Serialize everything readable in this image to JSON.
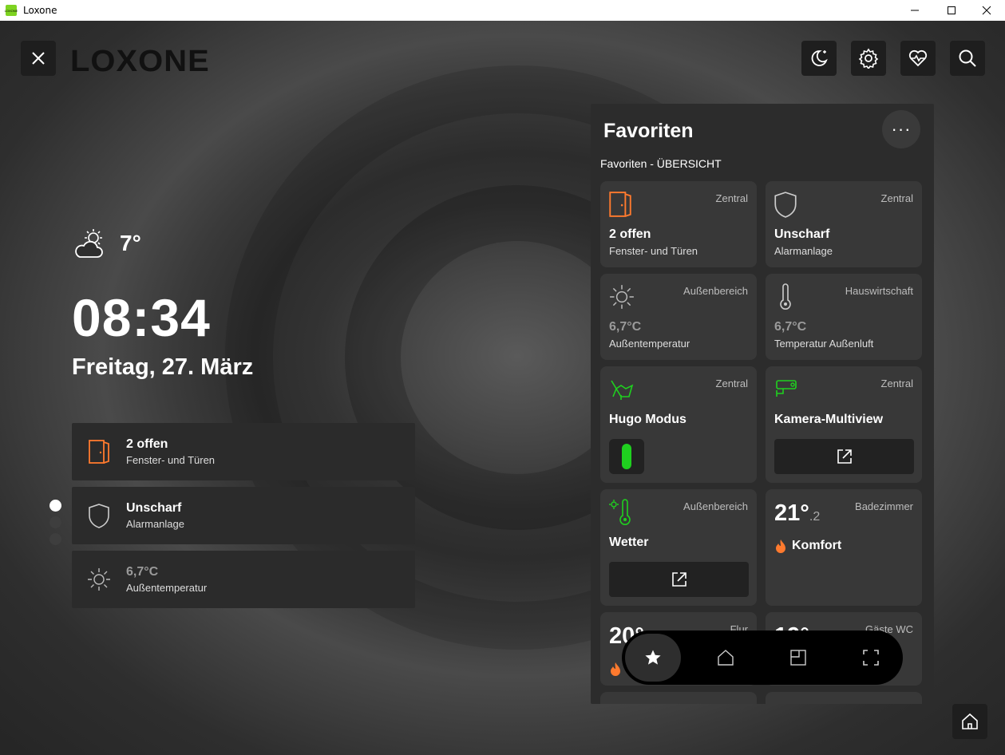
{
  "window": {
    "title": "Loxone",
    "app_icon_text": "LOXONE"
  },
  "header": {
    "logo": "LOXONE"
  },
  "weather": {
    "temperature": "7°"
  },
  "clock": {
    "time": "08:34",
    "date": "Freitag, 27. März"
  },
  "left_cards": [
    {
      "title": "2 offen",
      "subtitle": "Fenster- und Türen",
      "icon": "door-icon"
    },
    {
      "title": "Unscharf",
      "subtitle": "Alarmanlage",
      "icon": "shield-icon"
    },
    {
      "title": "6,7°C",
      "subtitle": "Außentemperatur",
      "icon": "sun-icon"
    }
  ],
  "page_dots": 3,
  "favorites": {
    "title": "Favoriten",
    "more": "···",
    "subheading": "Favoriten - ÜBERSICHT",
    "tiles": [
      {
        "room": "Zentral",
        "value": "2 offen",
        "label": "Fenster- und Türen",
        "icon": "door-icon"
      },
      {
        "room": "Zentral",
        "value": "Unscharf",
        "label": "Alarmanlage",
        "icon": "shield-icon"
      },
      {
        "room": "Außenbereich",
        "value": "6,7°C",
        "label": "Außentemperatur",
        "icon": "sun-icon"
      },
      {
        "room": "Hauswirtschaft",
        "value": "6,7°C",
        "label": "Temperatur Außenluft",
        "icon": "thermometer-icon"
      },
      {
        "room": "Zentral",
        "value": "Hugo Modus",
        "icon": "hugo-icon"
      },
      {
        "room": "Zentral",
        "value": "Kamera-Multiview",
        "icon": "camera-icon"
      },
      {
        "room": "Außenbereich",
        "value": "Wetter",
        "icon": "weather-thermometer-icon"
      },
      {
        "room": "Badezimmer",
        "temp_int": "21",
        "temp_dec": ".2",
        "mode": "Komfort",
        "icon": "flame-icon"
      },
      {
        "room": "Flur",
        "temp_int": "20"
      },
      {
        "room": "Gäste WC",
        "temp_int": "19"
      }
    ]
  },
  "nav": {
    "items": [
      "favorites",
      "rooms",
      "categories",
      "fullscreen"
    ]
  },
  "colors": {
    "accent_green": "#1fd01f",
    "accent_orange": "#ff7a2e"
  }
}
